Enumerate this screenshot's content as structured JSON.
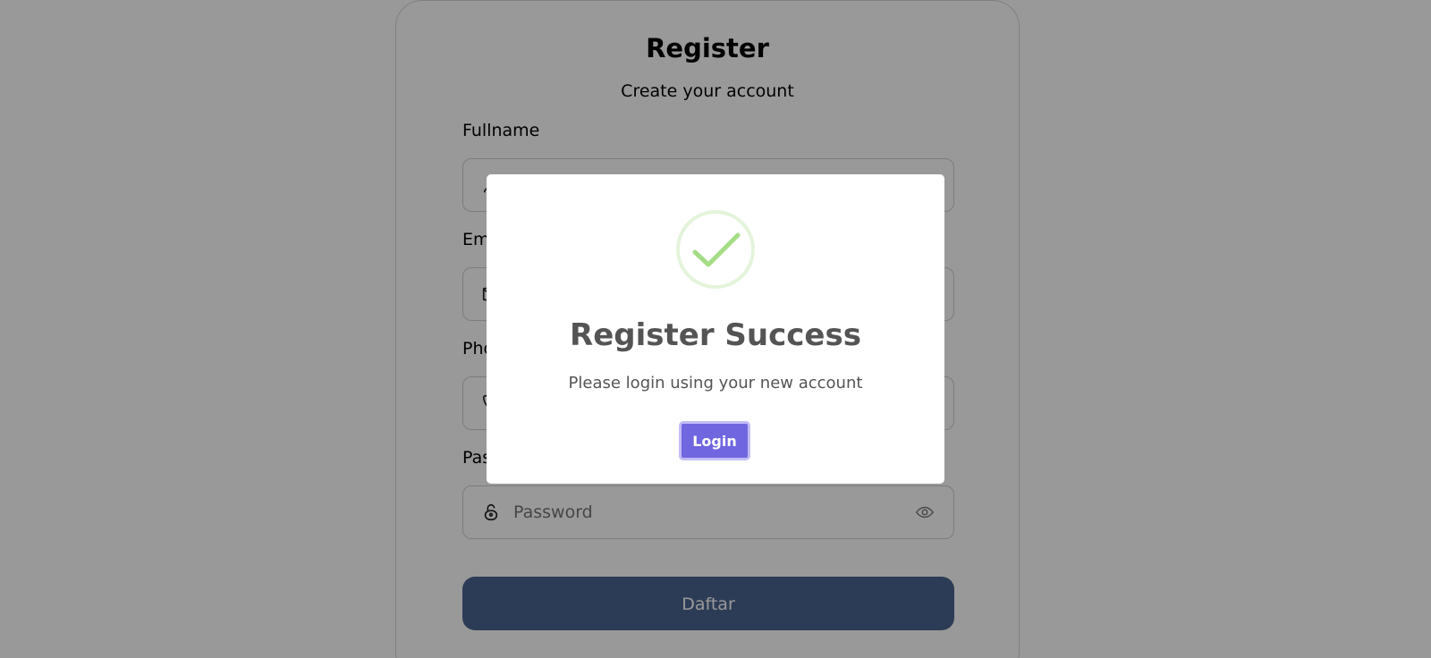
{
  "form": {
    "title": "Register",
    "subtitle": "Create your account",
    "fields": [
      {
        "label": "Fullname",
        "placeholder": "",
        "icon": "user-icon"
      },
      {
        "label": "Email",
        "placeholder": "",
        "icon": "mail-icon"
      },
      {
        "label": "Phone",
        "placeholder": "",
        "icon": "phone-icon"
      },
      {
        "label": "Password",
        "placeholder": "Password",
        "icon": "lock-icon"
      }
    ],
    "submit_label": "Daftar"
  },
  "modal": {
    "icon": "check-circle-icon",
    "title": "Register Success",
    "text": "Please login using your new account",
    "button_label": "Login"
  },
  "colors": {
    "overlay": "#000000",
    "success": "#a5dc86",
    "confirm_button": "#7066e0",
    "submit_button": "#4c6490"
  }
}
